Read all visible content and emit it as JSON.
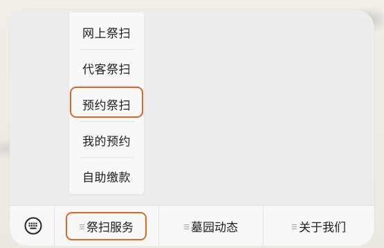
{
  "popup_menu": {
    "items": [
      {
        "label": "网上祭扫"
      },
      {
        "label": "代客祭扫"
      },
      {
        "label": "预约祭扫",
        "highlighted": true
      },
      {
        "label": "我的预约"
      },
      {
        "label": "自助缴款"
      }
    ]
  },
  "bottom_bar": {
    "keyboard_icon": "keyboard-icon",
    "tabs": [
      {
        "label": "祭扫服务",
        "icon": "menu-icon",
        "highlighted": true
      },
      {
        "label": "墓园动态",
        "icon": "menu-icon"
      },
      {
        "label": "关于我们",
        "icon": "menu-icon"
      }
    ]
  },
  "colors": {
    "highlight": "#e0651f",
    "panel": "#ededed",
    "menu_bg": "#f8f8f8",
    "text": "#1d1d1d"
  }
}
